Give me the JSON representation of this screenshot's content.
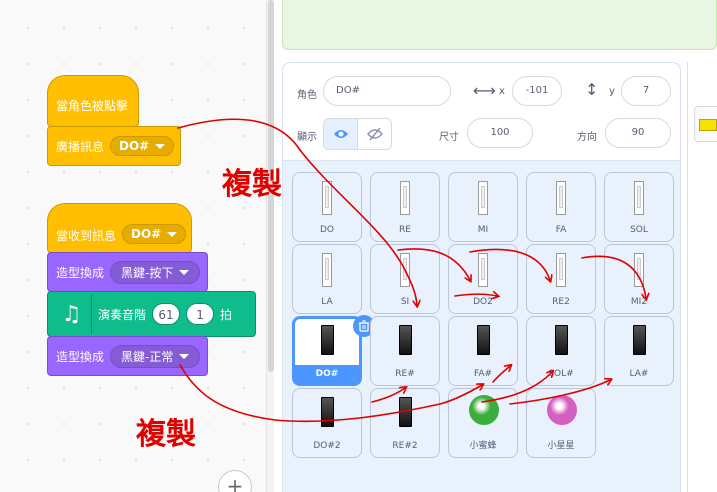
{
  "code": {
    "script1": {
      "hat_label": "當角色被點擊",
      "broadcast_label": "廣播訊息",
      "broadcast_value": "DO#"
    },
    "script2": {
      "hat_label": "當收到訊息",
      "hat_value": "DO#",
      "switch1_label": "造型換成",
      "switch1_value": "黑鍵-按下",
      "play_label": "演奏音階",
      "play_note": "61",
      "play_beats": "1",
      "play_unit": "拍",
      "switch2_label": "造型換成",
      "switch2_value": "黑鍵-正常"
    },
    "zoom_in_label": "+"
  },
  "annotations": {
    "copy_text_1": "複製",
    "copy_text_2": "複製",
    "arrow_color": "#e00000"
  },
  "sprite_info": {
    "sprite_label": "角色",
    "sprite_name": "DO#",
    "x_label": "x",
    "x_value": "-101",
    "y_label": "y",
    "y_value": "7",
    "show_label": "顯示",
    "size_label": "尺寸",
    "size_value": "100",
    "direction_label": "方向",
    "direction_value": "90"
  },
  "sprites": [
    {
      "name": "DO",
      "kind": "white"
    },
    {
      "name": "RE",
      "kind": "white"
    },
    {
      "name": "MI",
      "kind": "white"
    },
    {
      "name": "FA",
      "kind": "white"
    },
    {
      "name": "SOL",
      "kind": "white"
    },
    {
      "name": "LA",
      "kind": "white"
    },
    {
      "name": "SI",
      "kind": "white"
    },
    {
      "name": "DO2",
      "kind": "white"
    },
    {
      "name": "RE2",
      "kind": "white"
    },
    {
      "name": "MI2",
      "kind": "white"
    },
    {
      "name": "DO#",
      "kind": "black",
      "selected": true
    },
    {
      "name": "RE#",
      "kind": "black"
    },
    {
      "name": "FA#",
      "kind": "black"
    },
    {
      "name": "SOL#",
      "kind": "black"
    },
    {
      "name": "LA#",
      "kind": "black"
    },
    {
      "name": "DO#2",
      "kind": "black"
    },
    {
      "name": "RE#2",
      "kind": "black"
    },
    {
      "name": "小蜜蜂",
      "kind": "green-ball"
    },
    {
      "name": "小星星",
      "kind": "pink-ball"
    }
  ],
  "colors": {
    "event": "#ffbf00",
    "looks": "#9966ff",
    "music": "#0fbd8c",
    "selected": "#4c97ff",
    "green_ball": "#3cae3c",
    "pink_ball": "#d35fc2"
  }
}
